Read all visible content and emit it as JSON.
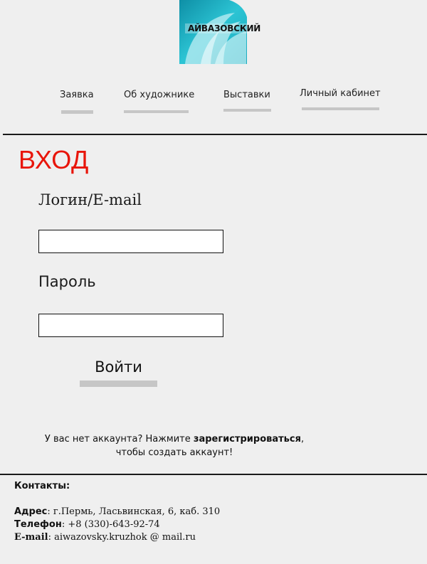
{
  "logo": {
    "text": "АЙВАЗОВСКИЙ",
    "icon": "wave-logo"
  },
  "nav": {
    "items": [
      {
        "label": "Заявка"
      },
      {
        "label": "Об художнике"
      },
      {
        "label": "Выставки"
      },
      {
        "label": "Личный кабинет"
      }
    ]
  },
  "login": {
    "title": "ВХОД",
    "login_label": "Логин/E-mail",
    "login_value": "",
    "password_label": "Пароль",
    "password_value": "",
    "submit_label": "Войти",
    "register_prefix": "У вас нет аккаунта? Нажмите ",
    "register_link": "зарегистрироваться",
    "register_suffix": ",",
    "register_line2": "чтобы создать аккаунт!"
  },
  "contacts": {
    "heading": "Контакты:",
    "address_label": "Адрес",
    "address_value": ": г.Пермь, Ласьвинская, 6, каб. 310",
    "phone_label": "Телефон",
    "phone_value": ": +8 (330)-643-92-74",
    "email_label": "E-mail",
    "email_value": ": aiwazovsky.kruzhok @ mail.ru"
  },
  "colors": {
    "title": "#e8150a",
    "nav_bar": "#c6c6c6",
    "logo_teal": "#1bb3c4"
  }
}
